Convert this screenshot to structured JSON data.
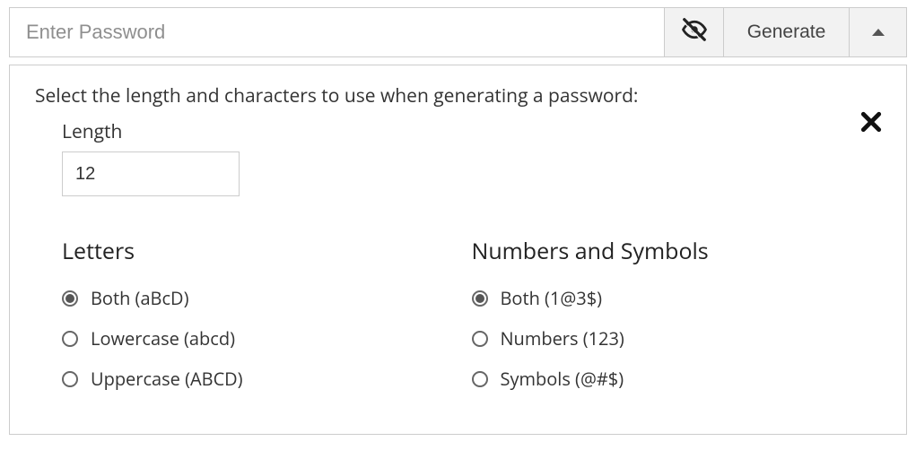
{
  "password_field": {
    "placeholder": "Enter Password",
    "value": ""
  },
  "generate_button_label": "Generate",
  "instruction": "Select the length and characters to use when generating a password:",
  "length": {
    "label": "Length",
    "value": "12"
  },
  "letters": {
    "heading": "Letters",
    "options": [
      {
        "label": "Both (aBcD)",
        "selected": true
      },
      {
        "label": "Lowercase (abcd)",
        "selected": false
      },
      {
        "label": "Uppercase (ABCD)",
        "selected": false
      }
    ]
  },
  "numbers_symbols": {
    "heading": "Numbers and Symbols",
    "options": [
      {
        "label": "Both (1@3$)",
        "selected": true
      },
      {
        "label": "Numbers (123)",
        "selected": false
      },
      {
        "label": "Symbols (@#$)",
        "selected": false
      }
    ]
  }
}
